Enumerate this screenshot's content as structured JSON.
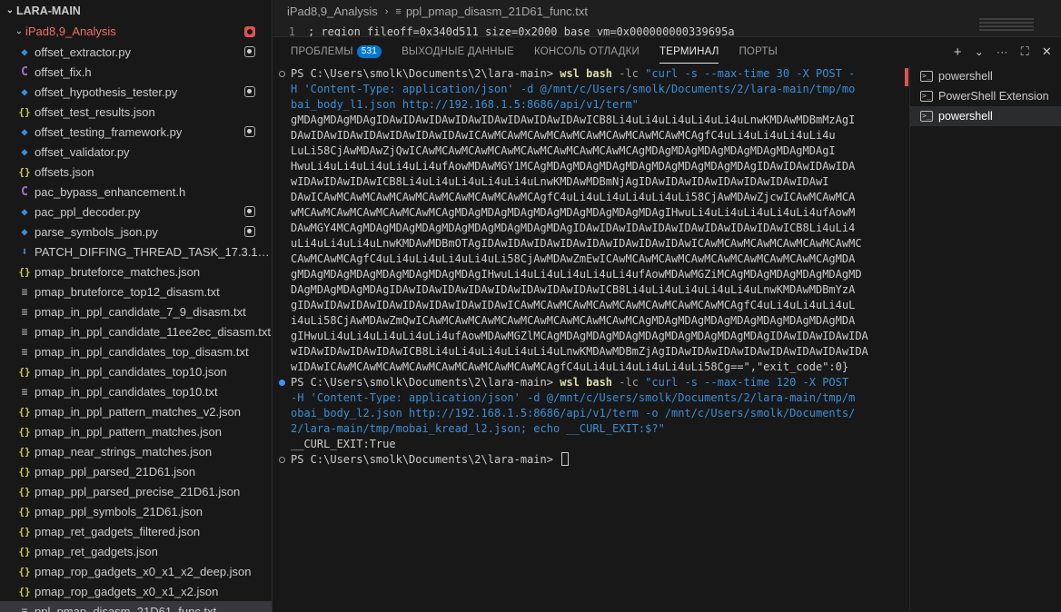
{
  "explorer": {
    "root_label": "LARA-MAIN",
    "folder_label": "iPad8,9_Analysis",
    "files": [
      {
        "name": "offset_extractor.py",
        "icon": "python-icon",
        "modified": true
      },
      {
        "name": "offset_fix.h",
        "icon": "c-header-icon",
        "modified": false
      },
      {
        "name": "offset_hypothesis_tester.py",
        "icon": "python-icon",
        "modified": true
      },
      {
        "name": "offset_test_results.json",
        "icon": "json-icon",
        "modified": false
      },
      {
        "name": "offset_testing_framework.py",
        "icon": "python-icon",
        "modified": true
      },
      {
        "name": "offset_validator.py",
        "icon": "python-icon",
        "modified": false
      },
      {
        "name": "offsets.json",
        "icon": "json-icon",
        "modified": false
      },
      {
        "name": "pac_bypass_enhancement.h",
        "icon": "c-header-icon",
        "modified": false
      },
      {
        "name": "pac_ppl_decoder.py",
        "icon": "python-icon",
        "modified": true
      },
      {
        "name": "parse_symbols_json.py",
        "icon": "python-icon",
        "modified": true
      },
      {
        "name": "PATCH_DIFFING_THREAD_TASK_17.3.1_vs_1...",
        "icon": "download-icon",
        "modified": false
      },
      {
        "name": "pmap_bruteforce_matches.json",
        "icon": "json-icon",
        "modified": false
      },
      {
        "name": "pmap_bruteforce_top12_disasm.txt",
        "icon": "text-icon",
        "modified": false
      },
      {
        "name": "pmap_in_ppl_candidate_7_9_disasm.txt",
        "icon": "text-icon",
        "modified": false
      },
      {
        "name": "pmap_in_ppl_candidate_11ee2ec_disasm.txt",
        "icon": "text-icon",
        "modified": false
      },
      {
        "name": "pmap_in_ppl_candidates_top_disasm.txt",
        "icon": "text-icon",
        "modified": false
      },
      {
        "name": "pmap_in_ppl_candidates_top10.json",
        "icon": "json-icon",
        "modified": false
      },
      {
        "name": "pmap_in_ppl_candidates_top10.txt",
        "icon": "text-icon",
        "modified": false
      },
      {
        "name": "pmap_in_ppl_pattern_matches_v2.json",
        "icon": "json-icon",
        "modified": false
      },
      {
        "name": "pmap_in_ppl_pattern_matches.json",
        "icon": "json-icon",
        "modified": false
      },
      {
        "name": "pmap_near_strings_matches.json",
        "icon": "json-icon",
        "modified": false
      },
      {
        "name": "pmap_ppl_parsed_21D61.json",
        "icon": "json-icon",
        "modified": false
      },
      {
        "name": "pmap_ppl_parsed_precise_21D61.json",
        "icon": "json-icon",
        "modified": false
      },
      {
        "name": "pmap_ppl_symbols_21D61.json",
        "icon": "json-icon",
        "modified": false
      },
      {
        "name": "pmap_ret_gadgets_filtered.json",
        "icon": "json-icon",
        "modified": false
      },
      {
        "name": "pmap_ret_gadgets.json",
        "icon": "json-icon",
        "modified": false
      },
      {
        "name": "pmap_rop_gadgets_x0_x1_x2_deep.json",
        "icon": "json-icon",
        "modified": false
      },
      {
        "name": "pmap_rop_gadgets_x0_x1_x2.json",
        "icon": "json-icon",
        "modified": false
      },
      {
        "name": "ppl_pmap_disasm_21D61_func.txt",
        "icon": "text-icon",
        "modified": false
      }
    ]
  },
  "editor": {
    "breadcrumb_folder": "iPad8,9_Analysis",
    "breadcrumb_file": "ppl_pmap_disasm_21D61_func.txt",
    "line_number": "1",
    "line_text": "; region fileoff=0x340d511 size=0x2000 base_vm=0x000000000339695a"
  },
  "panel": {
    "tabs": {
      "problems": "ПРОБЛЕМЫ",
      "problems_count": "531",
      "output": "ВЫХОДНЫЕ ДАННЫЕ",
      "debug_console": "КОНСОЛЬ ОТЛАДКИ",
      "terminal": "ТЕРМИНАЛ",
      "ports": "ПОРТЫ"
    },
    "actions": {
      "add": "+",
      "dropdown": "⌄",
      "more": "···",
      "maximize": "⛶",
      "close": "✕"
    }
  },
  "terminal": {
    "lines": [
      {
        "dot": "gray",
        "segments": [
          {
            "c": "t-prompt",
            "t": "PS C:\\Users\\smolk\\Documents\\2\\lara-main> "
          },
          {
            "c": "t-cmd",
            "t": "wsl bash"
          },
          {
            "c": "t-flag",
            "t": " -lc "
          },
          {
            "c": "t-str",
            "t": "\"curl -s --max-time 30 -X POST -"
          }
        ]
      },
      {
        "segments": [
          {
            "c": "t-str",
            "t": "H 'Content-Type: application/json' -d @/mnt/c/Users/smolk/Documents/2/lara-main/tmp/mo"
          }
        ]
      },
      {
        "segments": [
          {
            "c": "t-str",
            "t": "bai_body_l1.json http://192.168.1.5:8686/api/v1/term\""
          }
        ]
      },
      {
        "segments": [
          {
            "c": "t-out",
            "t": "gMDAgMDAgMDAgIDAwIDAwIDAwIDAwIDAwIDAwIDAwIDAwICB8Li4uLi4uLi4uLi4uLi4uLnwKMDAwMDBmMzAgI"
          }
        ]
      },
      {
        "segments": [
          {
            "c": "t-out",
            "t": "DAwIDAwIDAwIDAwIDAwIDAwIDAwICAwMCAwMCAwMCAwMCAwMCAwMCAwMCAwMCAgfC4uLi4uLi4uLi4uLi4u"
          }
        ]
      },
      {
        "segments": [
          {
            "c": "t-out",
            "t": "LuLi58CjAwMDAwZjQwICAwMCAwMCAwMCAwMCAwMCAwMCAwMCAwMCAgMDAgMDAgMDAgMDAgMDAgMDAgMDAgI"
          }
        ]
      },
      {
        "segments": [
          {
            "c": "t-out",
            "t": "HwuLi4uLi4uLi4uLi4uLi4ufAowMDAwMGY1MCAgMDAgMDAgMDAgMDAgMDAgMDAgMDAgMDAgIDAwIDAwIDAwIDA"
          }
        ]
      },
      {
        "segments": [
          {
            "c": "t-out",
            "t": "wIDAwIDAwIDAwICB8Li4uLi4uLi4uLi4uLi4uLnwKMDAwMDBmNjAgIDAwIDAwIDAwIDAwIDAwIDAwIDAwI"
          }
        ]
      },
      {
        "segments": [
          {
            "c": "t-out",
            "t": "DAwICAwMCAwMCAwMCAwMCAwMCAwMCAwMCAwMCAgfC4uLi4uLi4uLi4uLi4uLi58CjAwMDAwZjcwICAwMCAwMCA"
          }
        ]
      },
      {
        "segments": [
          {
            "c": "t-out",
            "t": "wMCAwMCAwMCAwMCAwMCAwMCAgMDAgMDAgMDAgMDAgMDAgMDAgMDAgMDAgIHwuLi4uLi4uLi4uLi4uLi4ufAowM"
          }
        ]
      },
      {
        "segments": [
          {
            "c": "t-out",
            "t": "DAwMGY4MCAgMDAgMDAgMDAgMDAgMDAgMDAgMDAgMDAgIDAwIDAwIDAwIDAwIDAwIDAwIDAwIDAwICB8Li4uLi4"
          }
        ]
      },
      {
        "segments": [
          {
            "c": "t-out",
            "t": "uLi4uLi4uLi4uLnwKMDAwMDBmOTAgIDAwIDAwIDAwIDAwIDAwIDAwIDAwIDAwICAwMCAwMCAwMCAwMCAwMCAwMC"
          }
        ]
      },
      {
        "segments": [
          {
            "c": "t-out",
            "t": "CAwMCAwMCAgfC4uLi4uLi4uLi4uLi4uLi58CjAwMDAwZmEwICAwMCAwMCAwMCAwMCAwMCAwMCAwMCAwMCAgMDA"
          }
        ]
      },
      {
        "segments": [
          {
            "c": "t-out",
            "t": "gMDAgMDAgMDAgMDAgMDAgMDAgMDAgIHwuLi4uLi4uLi4uLi4uLi4ufAowMDAwMGZiMCAgMDAgMDAgMDAgMDAgMD"
          }
        ]
      },
      {
        "segments": [
          {
            "c": "t-out",
            "t": "DAgMDAgMDAgMDAgIDAwIDAwIDAwIDAwIDAwIDAwIDAwIDAwICB8Li4uLi4uLi4uLi4uLi4uLnwKMDAwMDBmYzA"
          }
        ]
      },
      {
        "segments": [
          {
            "c": "t-out",
            "t": "gIDAwIDAwIDAwIDAwIDAwIDAwIDAwIDAwICAwMCAwMCAwMCAwMCAwMCAwMCAwMCAwMCAgfC4uLi4uLi4uLi4uL"
          }
        ]
      },
      {
        "segments": [
          {
            "c": "t-out",
            "t": "i4uLi58CjAwMDAwZmQwICAwMCAwMCAwMCAwMCAwMCAwMCAwMCAwMCAgMDAgMDAgMDAgMDAgMDAgMDAgMDAgMDA"
          }
        ]
      },
      {
        "segments": [
          {
            "c": "t-out",
            "t": "gIHwuLi4uLi4uLi4uLi4uLi4ufAowMDAwMGZlMCAgMDAgMDAgMDAgMDAgMDAgMDAgMDAgMDAgIDAwIDAwIDAwIDA"
          }
        ]
      },
      {
        "segments": [
          {
            "c": "t-out",
            "t": "wIDAwIDAwIDAwIDAwICB8Li4uLi4uLi4uLi4uLi4uLnwKMDAwMDBmZjAgIDAwIDAwIDAwIDAwIDAwIDAwIDAwIDA"
          }
        ]
      },
      {
        "segments": [
          {
            "c": "t-out",
            "t": "wIDAwICAwMCAwMCAwMCAwMCAwMCAwMCAwMCAwMCAgfC4uLi4uLi4uLi4uLi4uLi58Cg==\",\"exit_code\":0}"
          }
        ]
      },
      {
        "dot": "blue",
        "segments": [
          {
            "c": "t-prompt",
            "t": "PS C:\\Users\\smolk\\Documents\\2\\lara-main> "
          },
          {
            "c": "t-cmd",
            "t": "wsl bash"
          },
          {
            "c": "t-flag",
            "t": " -lc "
          },
          {
            "c": "t-str",
            "t": "\"curl -s --max-time 120 -X POST"
          }
        ]
      },
      {
        "segments": [
          {
            "c": "t-str",
            "t": "-H 'Content-Type: application/json' -d @/mnt/c/Users/smolk/Documents/2/lara-main/tmp/m"
          }
        ]
      },
      {
        "segments": [
          {
            "c": "t-str",
            "t": "obai_body_l2.json http://192.168.1.5:8686/api/v1/term -o /mnt/c/Users/smolk/Documents/"
          }
        ]
      },
      {
        "segments": [
          {
            "c": "t-str",
            "t": "2/lara-main/tmp/mobai_kread_l2.json; echo __CURL_EXIT:$?\""
          }
        ]
      },
      {
        "segments": [
          {
            "c": "t-out",
            "t": "__CURL_EXIT:True"
          }
        ]
      },
      {
        "dot": "gray",
        "cursor": true,
        "segments": [
          {
            "c": "t-prompt",
            "t": "PS C:\\Users\\smolk\\Documents\\2\\lara-main> "
          }
        ]
      }
    ]
  },
  "terminal_list": {
    "items": [
      {
        "label": "powershell",
        "active": false
      },
      {
        "label": "PowerShell Extension",
        "active": false
      },
      {
        "label": "powershell",
        "active": true
      }
    ]
  }
}
